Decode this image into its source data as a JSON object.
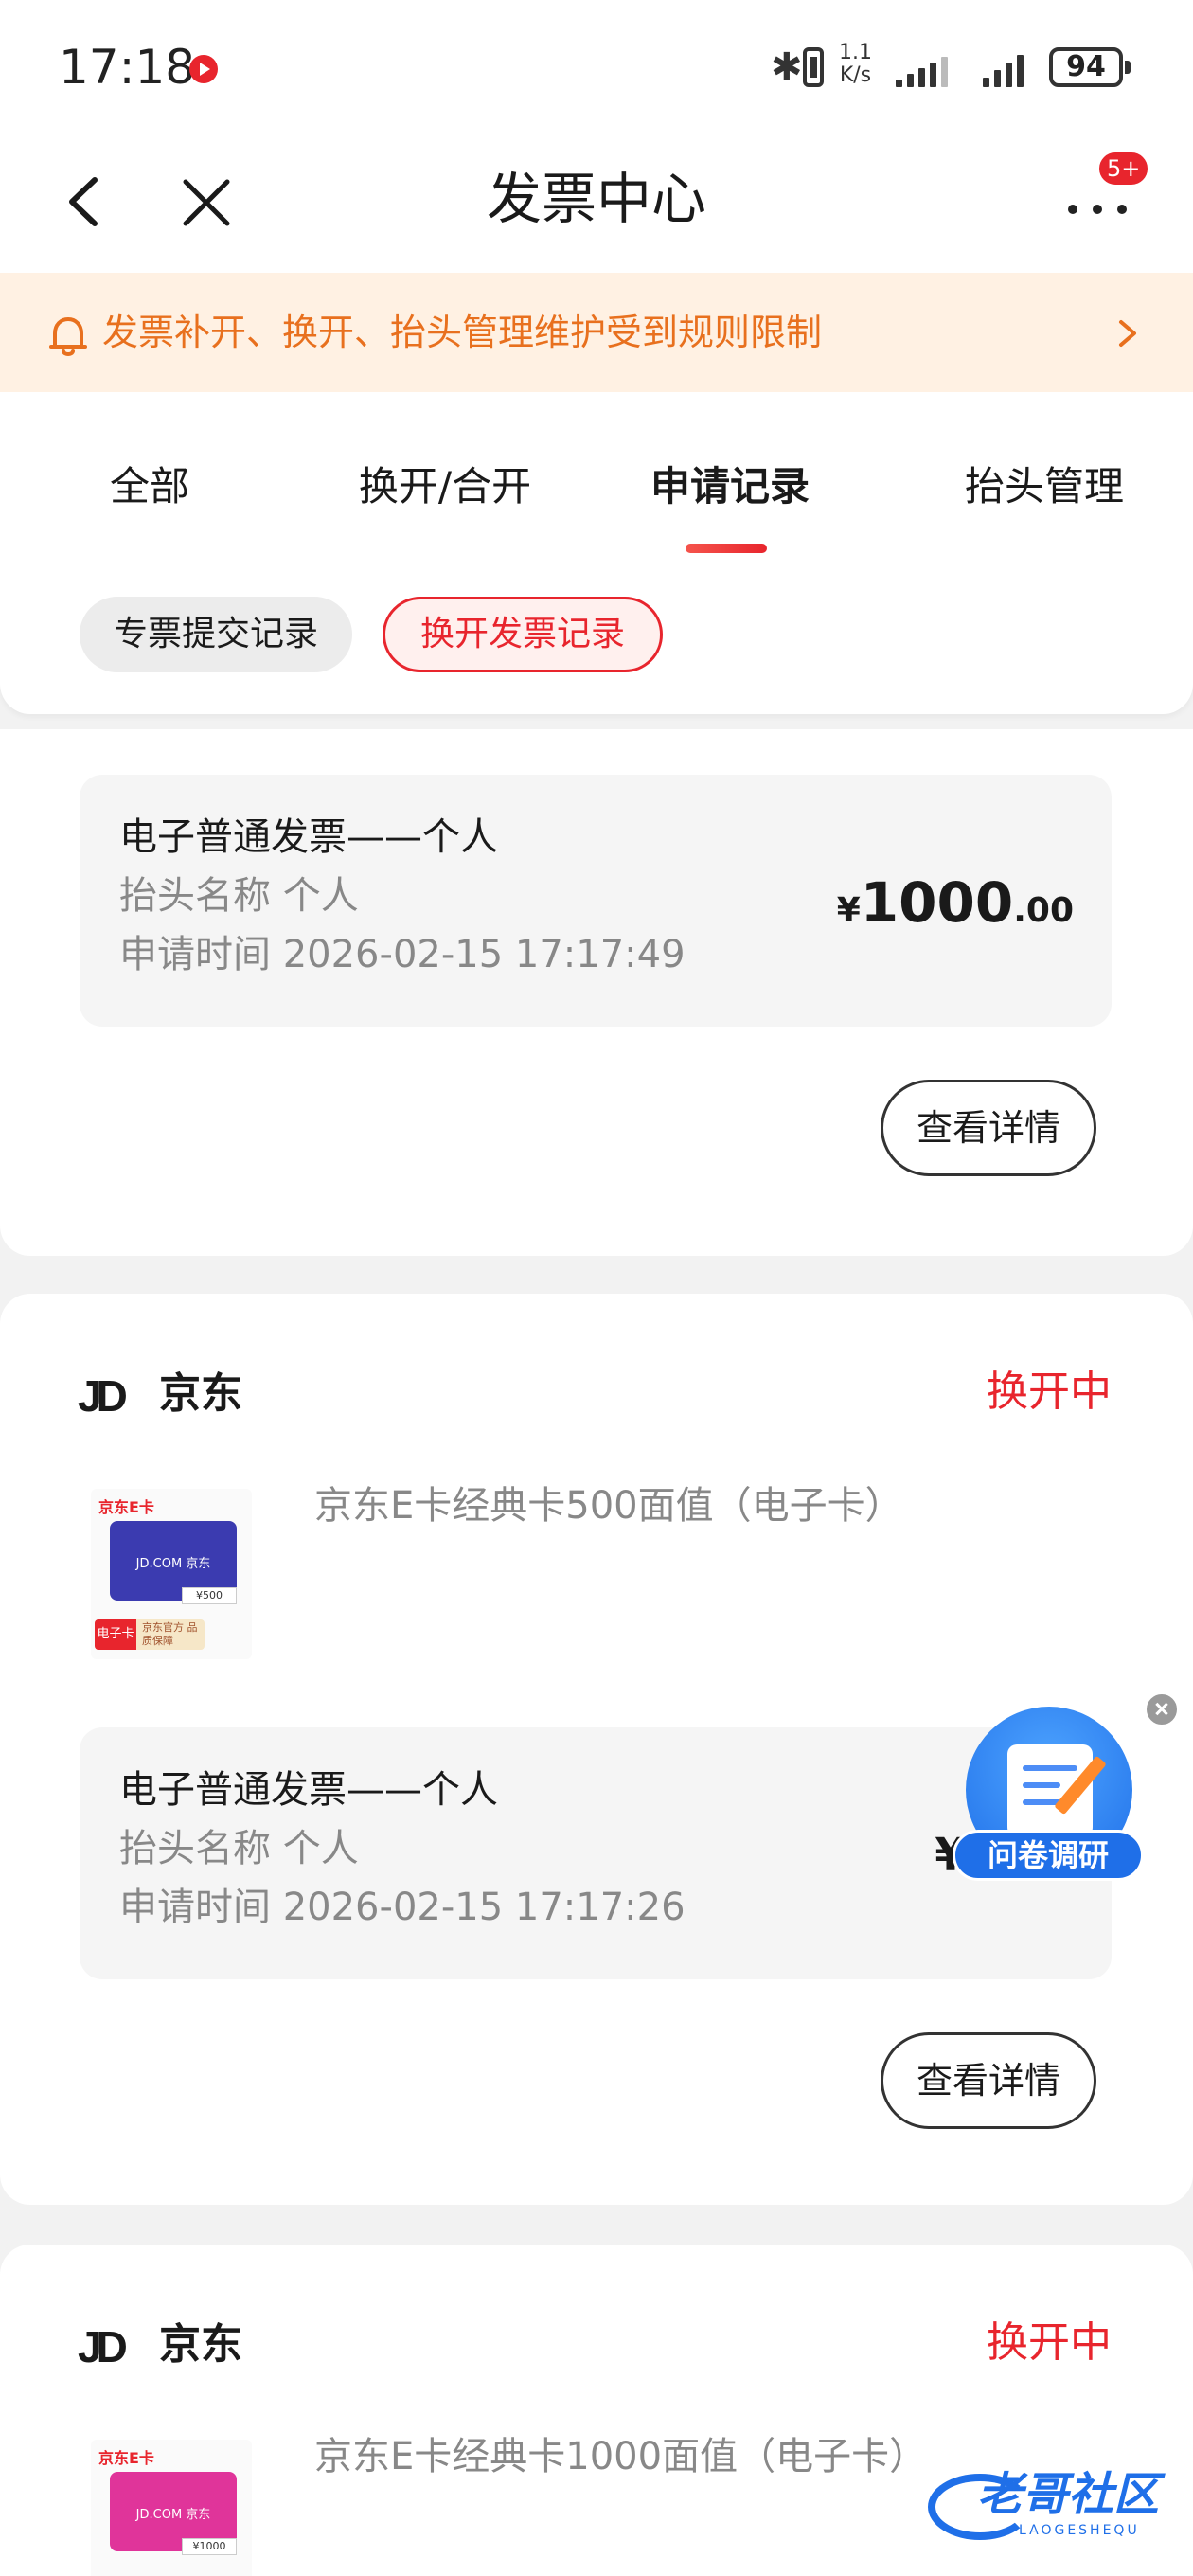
{
  "status_bar": {
    "time": "17:18",
    "net_speed_value": "1.1",
    "net_speed_unit": "K/s",
    "battery": "94",
    "icons": [
      "screen-record-icon",
      "bluetooth-icon",
      "vibrate-icon",
      "signal-icon",
      "battery-icon"
    ]
  },
  "nav": {
    "title": "发票中心",
    "badge": "5+",
    "icons": [
      "back-arrow-icon",
      "close-icon",
      "more-icon"
    ]
  },
  "notice": {
    "text": "发票补开、换开、抬头管理维护受到规则限制",
    "icons": [
      "bell-icon",
      "chevron-right-icon"
    ]
  },
  "tabs": [
    {
      "label": "全部",
      "active": false
    },
    {
      "label": "换开/合开",
      "active": false
    },
    {
      "label": "申请记录",
      "active": true
    },
    {
      "label": "抬头管理",
      "active": false
    }
  ],
  "subtabs": [
    {
      "label": "专票提交记录",
      "active": false
    },
    {
      "label": "换开发票记录",
      "active": true
    }
  ],
  "records": [
    {
      "invoice_type": "电子普通发票——个人",
      "header": "抬头名称 个人",
      "time": "申请时间 2026-02-15 17:17:49",
      "amount_currency": "¥",
      "amount_int": "1000",
      "amount_dec": ".00",
      "detail_label": "查看详情"
    },
    {
      "shop_logo": "JD",
      "shop": "京东",
      "status": "换开中",
      "product": "京东E卡经典卡500面值（电子卡）",
      "thumb_brand": "京东E卡",
      "thumb_card": "JD.COM 京东",
      "thumb_face": "¥500",
      "thumb_tag": "电子卡",
      "thumb_tag_note": "京东官方 品质保障",
      "invoice_type": "电子普通发票——个人",
      "header": "抬头名称 个人",
      "time": "申请时间 2026-02-15 17:17:26",
      "amount_visible": "¥5",
      "detail_label": "查看详情"
    },
    {
      "shop_logo": "JD",
      "shop": "京东",
      "status": "换开中",
      "product": "京东E卡经典卡1000面值（电子卡）",
      "thumb_brand": "京东E卡",
      "thumb_card": "JD.COM 京东",
      "thumb_face": "¥1000"
    }
  ],
  "survey": {
    "label": "问卷调研"
  },
  "watermark": {
    "text": "老哥社区",
    "sub": "LAOGESHEQU"
  },
  "colors": {
    "accent": "#e8252d",
    "notice_text": "#e8701e",
    "notice_bg": "#fff1e3",
    "survey_blue": "#1f6fe8",
    "card_purple": "#3b3bb0",
    "card_pink": "#e0349a"
  }
}
